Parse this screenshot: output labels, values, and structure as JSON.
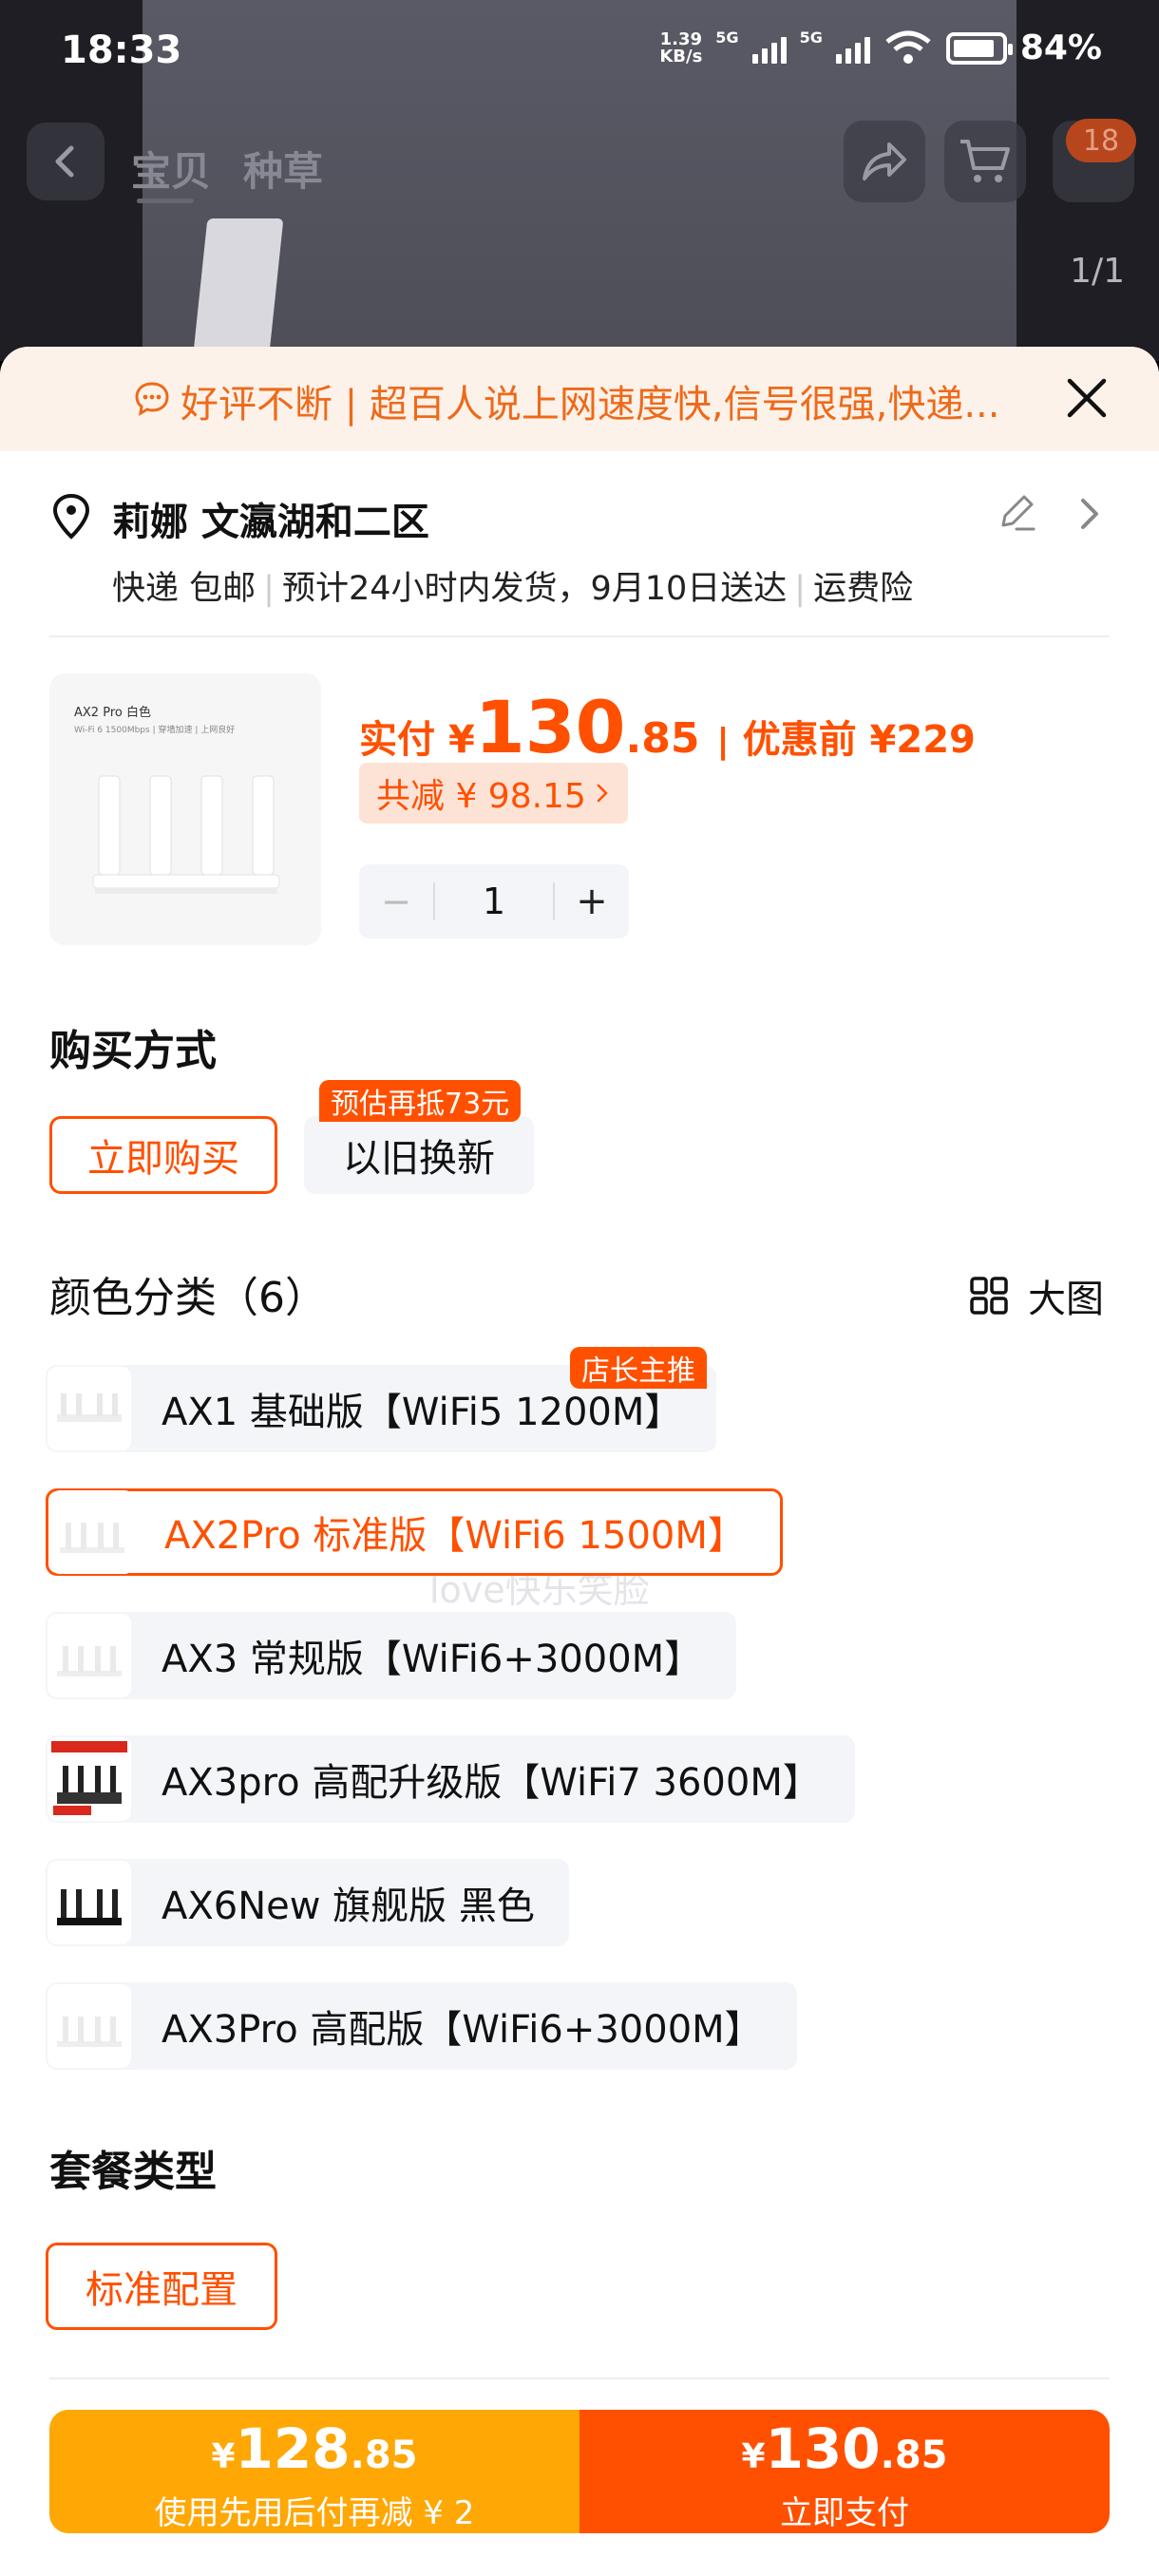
{
  "status_bar": {
    "time": "18:33",
    "speed_top": "1.39",
    "speed_bottom": "KB/s",
    "net1": "5G",
    "net2": "5G",
    "battery": "84%"
  },
  "nav": {
    "tabs": [
      "宝贝",
      "种草"
    ],
    "cart_badge": "18",
    "page_indicator": "1/1"
  },
  "banner": {
    "text": "好评不断 | 超百人说上网速度快,信号很强,快递..."
  },
  "address": {
    "name": "莉娜 文瀛湖和二区",
    "shipping": [
      "快递 包邮",
      "预计24小时内发货，9月10日送达",
      "运费险"
    ]
  },
  "product": {
    "image_caption": "AX2 Pro 白色",
    "image_subcaption": "Wi-Fi 6 1500Mbps | 穿墙加速 | 上网良好",
    "price_label": "实付",
    "currency": "¥",
    "price_int": "130",
    "price_dec": ".85",
    "before_label": "优惠前 ¥229",
    "reduce_label": "共减 ¥ 98.15",
    "quantity": "1"
  },
  "purchase": {
    "title": "购买方式",
    "options": [
      "立即购买",
      "以旧换新"
    ],
    "tradein_tag": "预估再抵73元"
  },
  "watermark": "love快乐笑脸",
  "colors": {
    "title": "颜色分类（6）",
    "view_label": "大图",
    "promo_tag": "店长主推",
    "items": [
      "AX1 基础版【WiFi5 1200M】",
      "AX2Pro 标准版【WiFi6 1500M】",
      "AX3 常规版【WiFi6+3000M】",
      "AX3pro 高配升级版【WiFi7 3600M】",
      "AX6New  旗舰版 黑色",
      "AX3Pro 高配版【WiFi6+3000M】"
    ],
    "selected_index": 1
  },
  "package": {
    "title": "套餐类型",
    "option": "标准配置"
  },
  "pay": {
    "left_yen": "¥",
    "left_int": "128",
    "left_dec": ".85",
    "left_sub": "使用先用后付再减 ¥ 2",
    "right_yen": "¥",
    "right_int": "130",
    "right_dec": ".85",
    "right_sub": "立即支付"
  },
  "colors_theme": {
    "accent": "#ff5000",
    "accent_light": "#fde3d6",
    "pay_left": "#ffa705"
  }
}
